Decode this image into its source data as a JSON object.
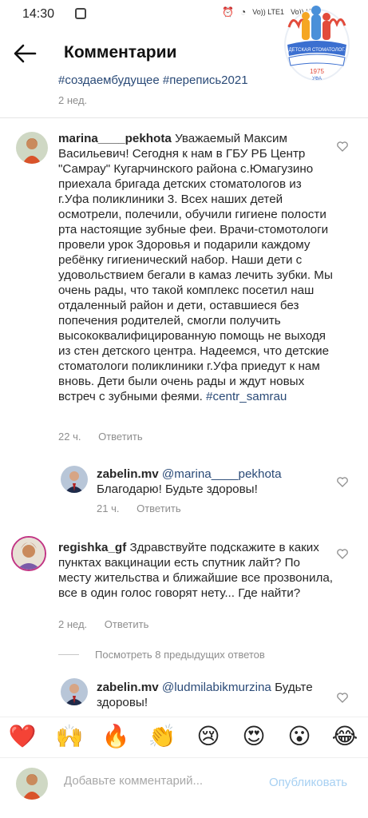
{
  "status": {
    "time": "14:30",
    "net1": "Vo)) LTE1",
    "net2": "Vo)) LTE2"
  },
  "logo": {
    "text": "Детская стоматологическая поликлиника №3",
    "year": "1975",
    "city": "УФА"
  },
  "header": {
    "title": "Комментарии"
  },
  "top_comment": {
    "hashtags": "#создаембудущее #перепись2021",
    "time": "2 нед."
  },
  "comments": [
    {
      "username": "marina____pekhota",
      "text": "Уважаемый Максим Васильевич! Сегодня к нам в ГБУ РБ Центр \"Самрау\" Кугарчинского района с.Юмагузино приехала бригада детских стоматологов из г.Уфа поликлиники 3. Всех наших детей осмотрели, полечили, обучили гигиене полости рта настоящие зубные феи. Врачи-стомотологи провели урок Здоровья и подарили каждому ребёнку гигиенический набор. Наши дети с удовольствием бегали в камаз лечить зубки. Мы очень рады, что такой комплекс посетил наш отдаленный район  и дети, оставшиеся без попечения родителей, смогли получить высококвалифицированную помощь не выходя из стен детского центра. Надеемся, что детские стоматологи поликлиники г.Уфа приедут к нам вновь. Дети были очень рады и ждут новых встреч с зубными феями.",
      "hashtag": "#centr_samrau",
      "time": "22 ч.",
      "reply": "Ответить"
    },
    {
      "username": "zabelin.mv",
      "mention": "@marina____pekhota",
      "text": "Благодарю! Будьте здоровы!",
      "time": "21 ч.",
      "reply": "Ответить"
    },
    {
      "username": "regishka_gf",
      "text": "Здравствуйте подскажите в каких пунктах вакцинации есть спутник лайт?  По месту жительства и ближайшие все прозвонила, все в один голос говорят нету... Где найти?",
      "time": "2 нед.",
      "reply": "Ответить"
    },
    {
      "username": "zabelin.mv",
      "mention": "@ludmilabikmurzina",
      "text": "Будьте здоровы!"
    }
  ],
  "view_previous": "Посмотреть 8 предыдущих ответов",
  "emojis": [
    "❤️",
    "🙌",
    "🔥",
    "👏",
    "😢",
    "😍",
    "😮",
    "😂"
  ],
  "composer": {
    "placeholder": "Добавьте комментарий...",
    "publish": "Опубликовать"
  },
  "colors": {
    "link": "#2a4a77",
    "muted": "#8e8e8e",
    "publish": "#a7d0f2"
  }
}
